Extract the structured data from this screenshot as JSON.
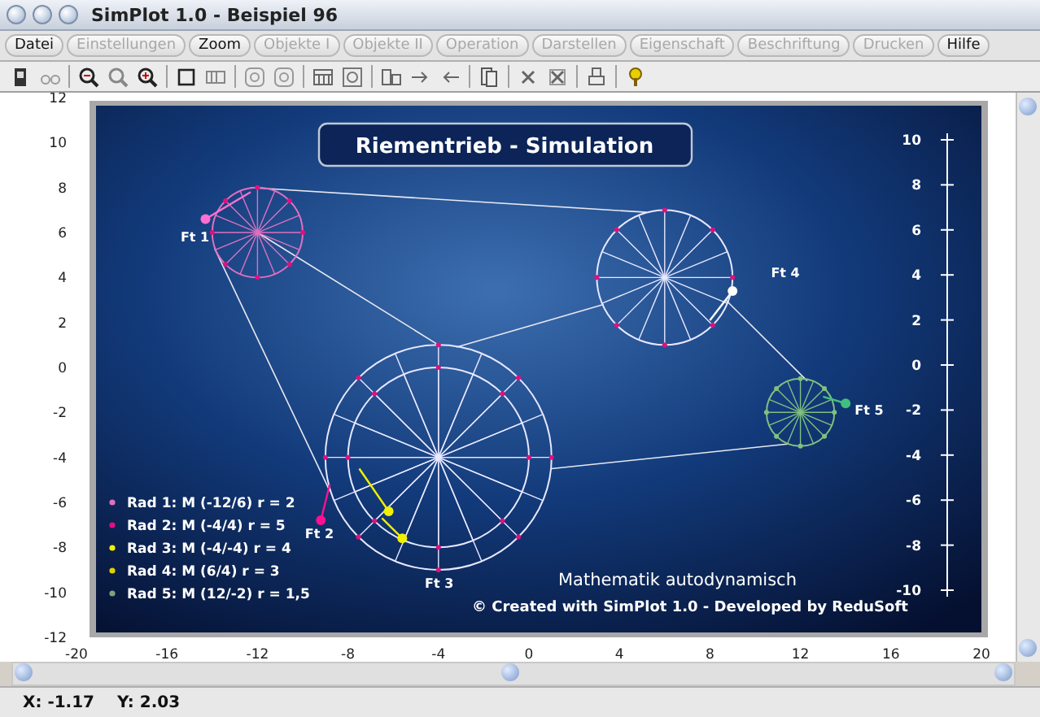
{
  "window": {
    "title": "SimPlot 1.0 - Beispiel 96"
  },
  "menu": [
    {
      "label": "Datei",
      "disabled": false
    },
    {
      "label": "Einstellungen",
      "disabled": true
    },
    {
      "label": "Zoom",
      "disabled": false
    },
    {
      "label": "Objekte I",
      "disabled": true
    },
    {
      "label": "Objekte II",
      "disabled": true
    },
    {
      "label": "Operation",
      "disabled": true
    },
    {
      "label": "Darstellen",
      "disabled": true
    },
    {
      "label": "Eigenschaft",
      "disabled": true
    },
    {
      "label": "Beschriftung",
      "disabled": true
    },
    {
      "label": "Drucken",
      "disabled": true
    },
    {
      "label": "Hilfe",
      "disabled": false
    }
  ],
  "plot": {
    "y_ticks": [
      "12",
      "10",
      "8",
      "6",
      "4",
      "2",
      "0",
      "-2",
      "-4",
      "-6",
      "-8",
      "-10",
      "-12"
    ],
    "x_ticks": [
      "-20",
      "-16",
      "-12",
      "-8",
      "-4",
      "0",
      "4",
      "8",
      "12",
      "16",
      "20"
    ],
    "right_axis_ticks": [
      "10",
      "8",
      "6",
      "4",
      "2",
      "0",
      "-2",
      "-4",
      "-6",
      "-8",
      "-10"
    ],
    "title": "Riementrieb - Simulation",
    "force_labels": [
      "Ft 1",
      "Ft 2",
      "Ft 3",
      "Ft 4",
      "Ft 5"
    ],
    "legend": [
      {
        "text": "Rad 1: M (-12/6) r = 2",
        "color": "#e070c0"
      },
      {
        "text": "Rad 2: M (-4/4) r = 5",
        "color": "#e01080"
      },
      {
        "text": "Rad 3: M (-4/-4) r = 4",
        "color": "#f0f000"
      },
      {
        "text": "Rad 4: M (6/4) r = 3",
        "color": "#e0d000"
      },
      {
        "text": "Rad 5: M (12/-2) r = 1,5",
        "color": "#80a080"
      }
    ],
    "subtitle": "Mathematik autodynamisch",
    "credit": "© Created with SimPlot 1.0 - Developed by ReduSoft"
  },
  "status_bar": {
    "x": "X: -1.17",
    "y": "Y: 2.03"
  }
}
